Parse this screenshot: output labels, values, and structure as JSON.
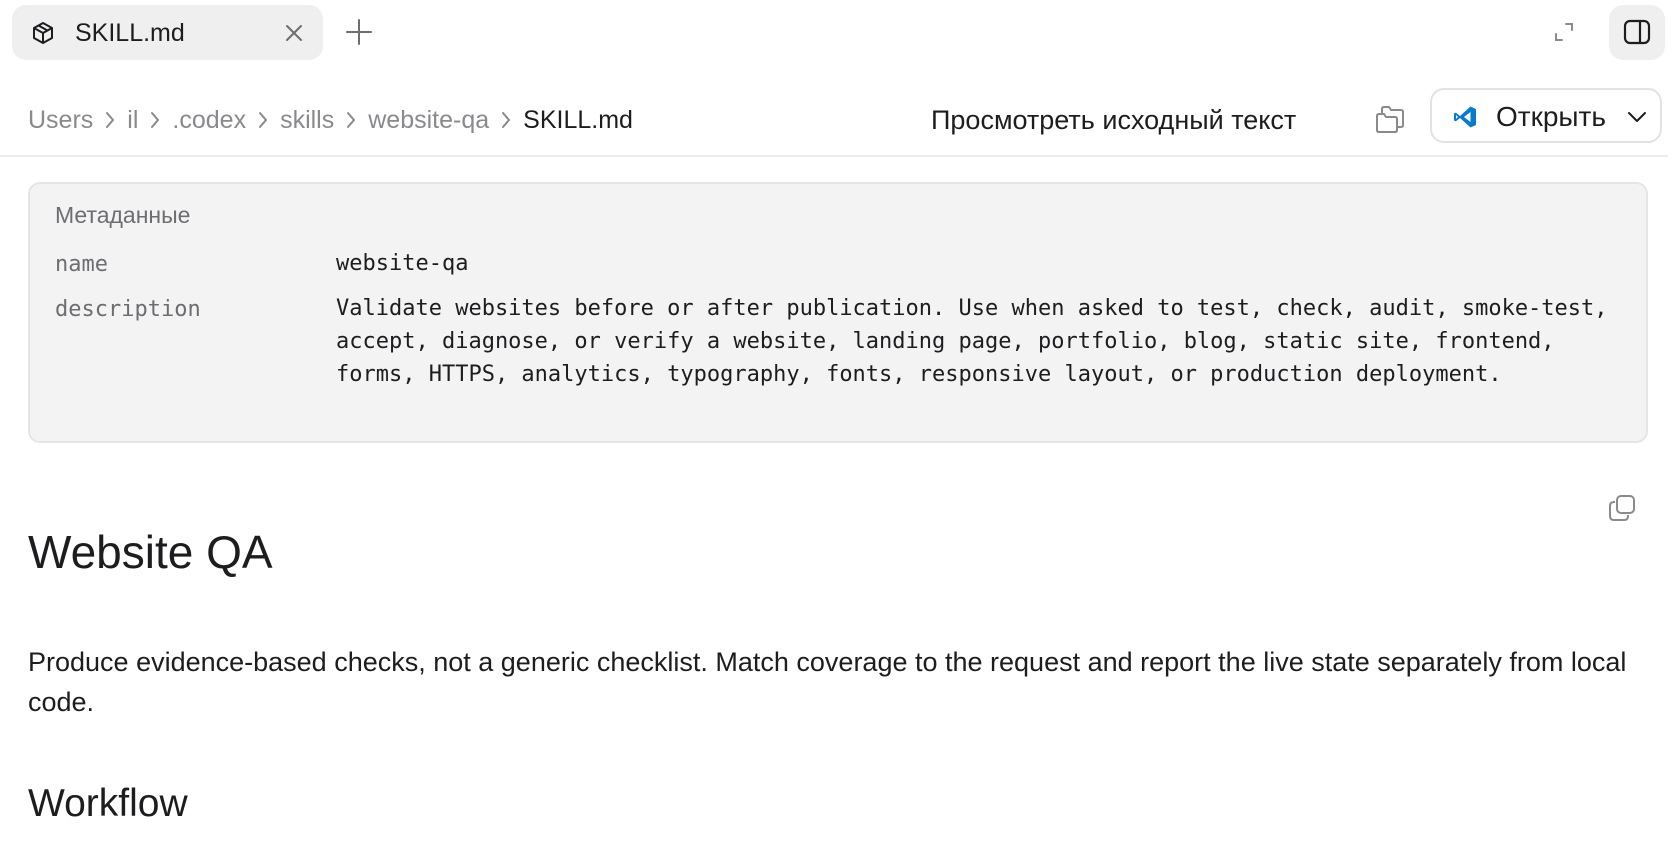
{
  "tab": {
    "title": "SKILL.md",
    "icon": "cube-icon"
  },
  "breadcrumb": {
    "items": [
      "Users",
      "il",
      ".codex",
      "skills",
      "website-qa",
      "SKILL.md"
    ]
  },
  "toolbar": {
    "view_source_label": "Просмотреть исходный текст",
    "open_label": "Открыть"
  },
  "metadata": {
    "title": "Метаданные",
    "rows": [
      {
        "key": "name",
        "value": "website-qa"
      },
      {
        "key": "description",
        "value": "Validate websites before or after publication. Use when asked to test, check, audit, smoke-test, accept, diagnose, or verify a website, landing page, portfolio, blog, static site, frontend, forms, HTTPS, analytics, typography, fonts, responsive layout, or production deployment."
      }
    ]
  },
  "document": {
    "heading": "Website QA",
    "paragraph": "Produce evidence-based checks, not a generic checklist. Match coverage to the request and report the live state separately from local code.",
    "subheading": "Workflow"
  },
  "colors": {
    "accent_vscode": "#0a7acc",
    "muted_text": "#8a8a8e",
    "metadata_bg": "#f3f3f3"
  }
}
